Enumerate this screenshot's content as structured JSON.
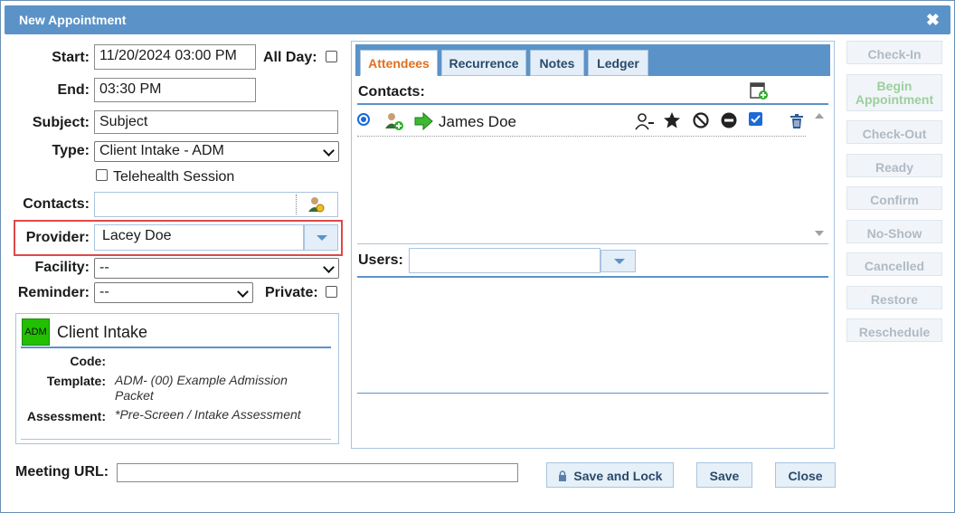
{
  "window": {
    "title": "New Appointment",
    "close_glyph": "✖"
  },
  "form": {
    "start_label": "Start:",
    "start_value": "11/20/2024 03:00 PM",
    "allday_label": "All Day:",
    "end_label": "End:",
    "end_value": "03:30 PM",
    "subject_label": "Subject:",
    "subject_value": "Subject",
    "type_label": "Type:",
    "type_value": "Client Intake - ADM",
    "telehealth_label": "Telehealth Session",
    "contacts_label": "Contacts:",
    "contacts_value": "",
    "provider_label": "Provider:",
    "provider_value": "Lacey Doe",
    "facility_label": "Facility:",
    "facility_value": "--",
    "reminder_label": "Reminder:",
    "reminder_value": "--",
    "private_label": "Private:"
  },
  "type_info": {
    "badge": "ADM",
    "badge_color": "#22c000",
    "title": "Client Intake",
    "code_label": "Code:",
    "code_value": "",
    "template_label": "Template:",
    "template_value": "ADM- (00) Example Admission Packet",
    "assessment_label": "Assessment:",
    "assessment_value": "*Pre-Screen / Intake Assessment"
  },
  "tabs": [
    {
      "label": "Attendees",
      "active": true
    },
    {
      "label": "Recurrence",
      "active": false
    },
    {
      "label": "Notes",
      "active": false
    },
    {
      "label": "Ledger",
      "active": false
    }
  ],
  "attendees": {
    "contacts_label": "Contacts:",
    "contacts": [
      {
        "name": "James Doe",
        "selected": true,
        "checked": true
      }
    ],
    "users_label": "Users:",
    "users_value": ""
  },
  "side_buttons": [
    "Check-In",
    "Begin Appointment",
    "Check-Out",
    "Ready",
    "Confirm",
    "No-Show",
    "Cancelled",
    "Restore",
    "Reschedule"
  ],
  "footer": {
    "meeting_url_label": "Meeting URL:",
    "meeting_url_value": "",
    "save_lock_label": "Save and Lock",
    "save_label": "Save",
    "close_label": "Close"
  },
  "colors": {
    "accent": "#5b93c8",
    "tab_active_text": "#e07020",
    "highlight_border": "#e04848"
  }
}
